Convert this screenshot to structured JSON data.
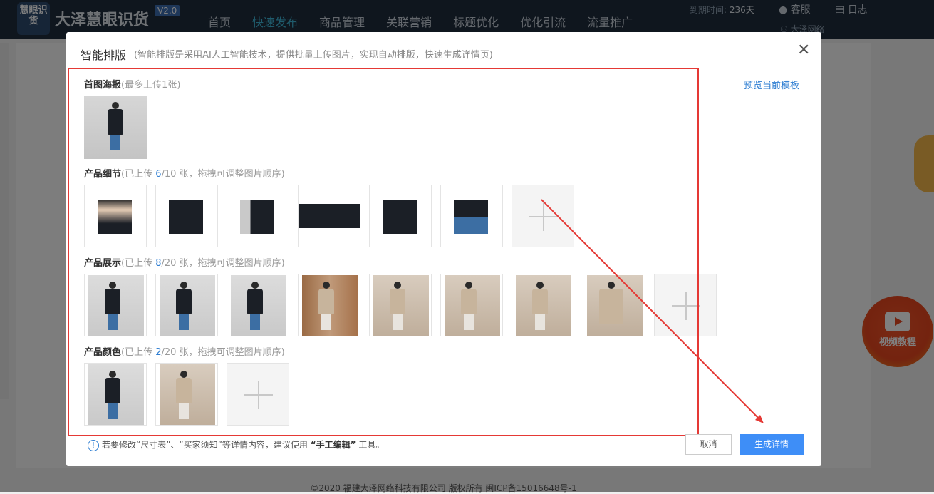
{
  "app": {
    "logo_text": "慧眼识货",
    "brand": "大泽慧眼识货",
    "version": "V2.0",
    "nav": [
      "首页",
      "快速发布",
      "商品管理",
      "关联营销",
      "标题优化",
      "优化引流",
      "流量推广"
    ],
    "expire_label": "到期时间:",
    "expire_days": "236天",
    "kefu": "客服",
    "rizhi": "日志",
    "company": "大泽网络",
    "footer": "©2020 福建大泽网络科技有限公司 版权所有 闽ICP备15016648号-1",
    "video_badge": "视频教程"
  },
  "dialog": {
    "title": "智能排版",
    "subtitle": "(智能排版是采用AI人工智能技术，提供批量上传图片，实现自动排版，快速生成详情页)",
    "preview_link": "预览当前模板",
    "sections": {
      "poster": {
        "name": "首图海报",
        "hint": "(最多上传1张)"
      },
      "detail": {
        "name": "产品细节",
        "hint_pre": "(已上传 ",
        "count": "6",
        "hint_post": "/10 张，拖拽可调整图片顺序)"
      },
      "display": {
        "name": "产品展示",
        "hint_pre": "(已上传 ",
        "count": "8",
        "hint_post": "/20 张，拖拽可调整图片顺序)"
      },
      "color": {
        "name": "产品颜色",
        "hint_pre": "(已上传 ",
        "count": "2",
        "hint_post": "/20 张，拖拽可调整图片顺序)"
      }
    },
    "notice_pre": "若要修改“尺寸表”、“买家须知”等详情内容，建议使用",
    "notice_tool": "“手工编辑”",
    "notice_post": "工具。",
    "cancel": "取消",
    "generate": "生成详情"
  },
  "colors": {
    "accent": "#3e8ef7",
    "annotation_red": "#e53935",
    "link": "#2d7dd2"
  }
}
